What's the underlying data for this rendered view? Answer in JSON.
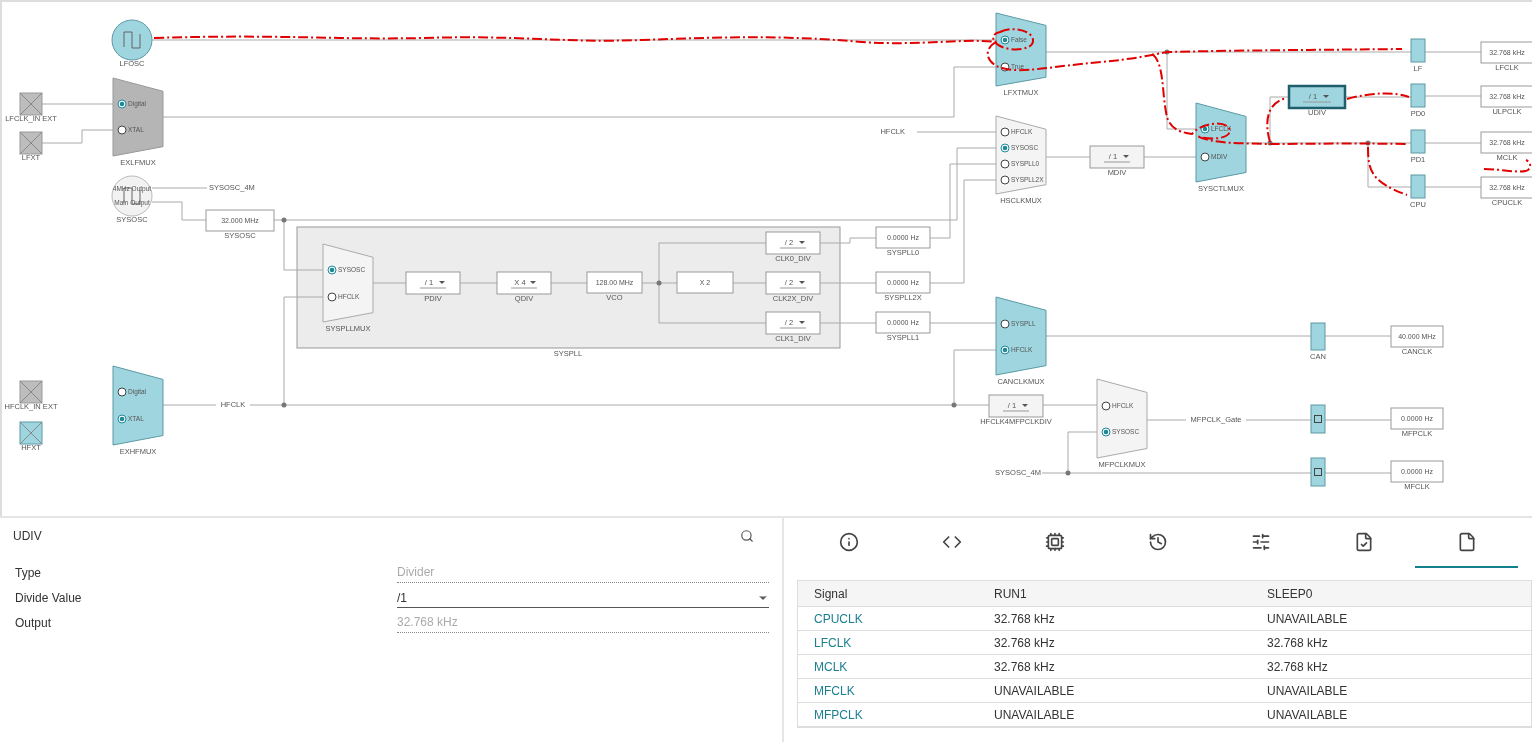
{
  "diagram": {
    "oscillators": [
      {
        "label": "LFOSC",
        "active": true
      },
      {
        "label": "SYSOSC",
        "active": false,
        "outputs": [
          "4MHz Output",
          "Main Output"
        ]
      }
    ],
    "pins": [
      {
        "label": "LFCLK_IN EXT",
        "active": false
      },
      {
        "label": "LFXT",
        "active": false
      },
      {
        "label": "HFCLK_IN EXT",
        "active": false
      },
      {
        "label": "HFXT",
        "active": true
      }
    ],
    "muxes": [
      {
        "label": "LFXTMUX",
        "kind": "active",
        "inputs": [
          {
            "label": "False",
            "selected": true
          },
          {
            "label": "True",
            "selected": false
          }
        ]
      },
      {
        "label": "EXLFMUX",
        "kind": "disabled",
        "inputs": [
          {
            "label": "Digital",
            "selected": true
          },
          {
            "label": "XTAL",
            "selected": false
          }
        ]
      },
      {
        "label": "HSCLKMUX",
        "kind": "idle",
        "inputs": [
          {
            "label": "HFCLK",
            "selected": false
          },
          {
            "label": "SYSOSC",
            "selected": true
          },
          {
            "label": "SYSPLL0",
            "selected": false
          },
          {
            "label": "SYSPLL2X",
            "selected": false
          }
        ]
      },
      {
        "label": "SYSCTLMUX",
        "kind": "active",
        "inputs": [
          {
            "label": "LFCLK",
            "selected": true
          },
          {
            "label": "MDIV",
            "selected": false
          }
        ]
      },
      {
        "label": "SYSPLLMUX",
        "kind": "idle",
        "inputs": [
          {
            "label": "SYSOSC",
            "selected": true
          },
          {
            "label": "HFCLK",
            "selected": false
          }
        ]
      },
      {
        "label": "CANCLKMUX",
        "kind": "active",
        "inputs": [
          {
            "label": "SYSPLL",
            "selected": false
          },
          {
            "label": "HFCLK",
            "selected": true
          }
        ]
      },
      {
        "label": "MFPCLKMUX",
        "kind": "idle",
        "inputs": [
          {
            "label": "HFCLK",
            "selected": false
          },
          {
            "label": "SYSOSC",
            "selected": true
          }
        ]
      },
      {
        "label": "EXHFMUX",
        "kind": "active",
        "inputs": [
          {
            "label": "Digital",
            "selected": false
          },
          {
            "label": "XTAL",
            "selected": true
          }
        ]
      }
    ],
    "dividers": [
      {
        "label": "UDIV",
        "value": "/ 1",
        "selected": true
      },
      {
        "label": "MDIV",
        "value": "/ 1",
        "selected": false
      },
      {
        "label": "PDIV",
        "value": "/ 1",
        "selected": false
      },
      {
        "label": "QDIV",
        "value": "X 4",
        "selected": false
      },
      {
        "label": "CLK0_DIV",
        "value": "/ 2",
        "selected": false
      },
      {
        "label": "CLK2X_DIV",
        "value": "/ 2",
        "selected": false
      },
      {
        "label": "CLK1_DIV",
        "value": "/ 2",
        "selected": false
      },
      {
        "label": "HFCLK4MFPCLKDIV",
        "value": "/ 1",
        "selected": false
      }
    ],
    "value_boxes": [
      {
        "label": "SYSOSC",
        "value": "32.000 MHz"
      },
      {
        "label": "VCO",
        "value": "128.00 MHz"
      },
      {
        "value": "X 2"
      },
      {
        "label": "SYSPLL0",
        "value": "0.0000 Hz"
      },
      {
        "label": "SYSPLL2X",
        "value": "0.0000 Hz"
      },
      {
        "label": "SYSPLL1",
        "value": "0.0000 Hz"
      }
    ],
    "outputs": [
      {
        "label": "LFCLK",
        "value": "32.768 kHz"
      },
      {
        "label": "ULPCLK",
        "value": "32.768 kHz"
      },
      {
        "label": "MCLK",
        "value": "32.768 kHz"
      },
      {
        "label": "CPUCLK",
        "value": "32.768 kHz"
      },
      {
        "label": "CANCLK",
        "value": "40.000 MHz"
      },
      {
        "label": "MFPCLK",
        "value": "0.0000 Hz"
      },
      {
        "label": "MFCLK",
        "value": "0.0000 Hz"
      }
    ],
    "gates": [
      {
        "kind": "plain",
        "label": "LF"
      },
      {
        "kind": "plain",
        "label": "PD0"
      },
      {
        "kind": "plain",
        "label": "PD1"
      },
      {
        "kind": "plain",
        "label": "CPU"
      },
      {
        "kind": "plain",
        "label": "CAN"
      },
      {
        "kind": "checkbox"
      },
      {
        "kind": "checkbox"
      }
    ],
    "net_labels": [
      "HFCLK",
      "SYSOSC_4M",
      "HFCLK",
      "MFPCLK_Gate",
      "SYSOSC_4M"
    ],
    "group_label": "SYSPLL"
  },
  "properties": {
    "title": "UDIV",
    "fields": [
      {
        "kind": "readonly",
        "label": "Type",
        "value": "Divider"
      },
      {
        "kind": "dropdown",
        "label": "Divide Value",
        "value": "/1"
      },
      {
        "kind": "readonly",
        "label": "Output",
        "value": "32.768 kHz"
      }
    ]
  },
  "tabs": [
    {
      "selected": false
    },
    {
      "selected": false
    },
    {
      "selected": false
    },
    {
      "selected": false
    },
    {
      "selected": false
    },
    {
      "selected": false
    },
    {
      "selected": true
    }
  ],
  "table": {
    "columns": [
      "Signal",
      "RUN1",
      "SLEEP0"
    ],
    "rows": [
      [
        "CPUCLK",
        "32.768 kHz",
        "UNAVAILABLE"
      ],
      [
        "LFCLK",
        "32.768 kHz",
        "32.768 kHz"
      ],
      [
        "MCLK",
        "32.768 kHz",
        "32.768 kHz"
      ],
      [
        "MFCLK",
        "UNAVAILABLE",
        "UNAVAILABLE"
      ],
      [
        "MFPCLK",
        "UNAVAILABLE",
        "UNAVAILABLE"
      ]
    ]
  }
}
